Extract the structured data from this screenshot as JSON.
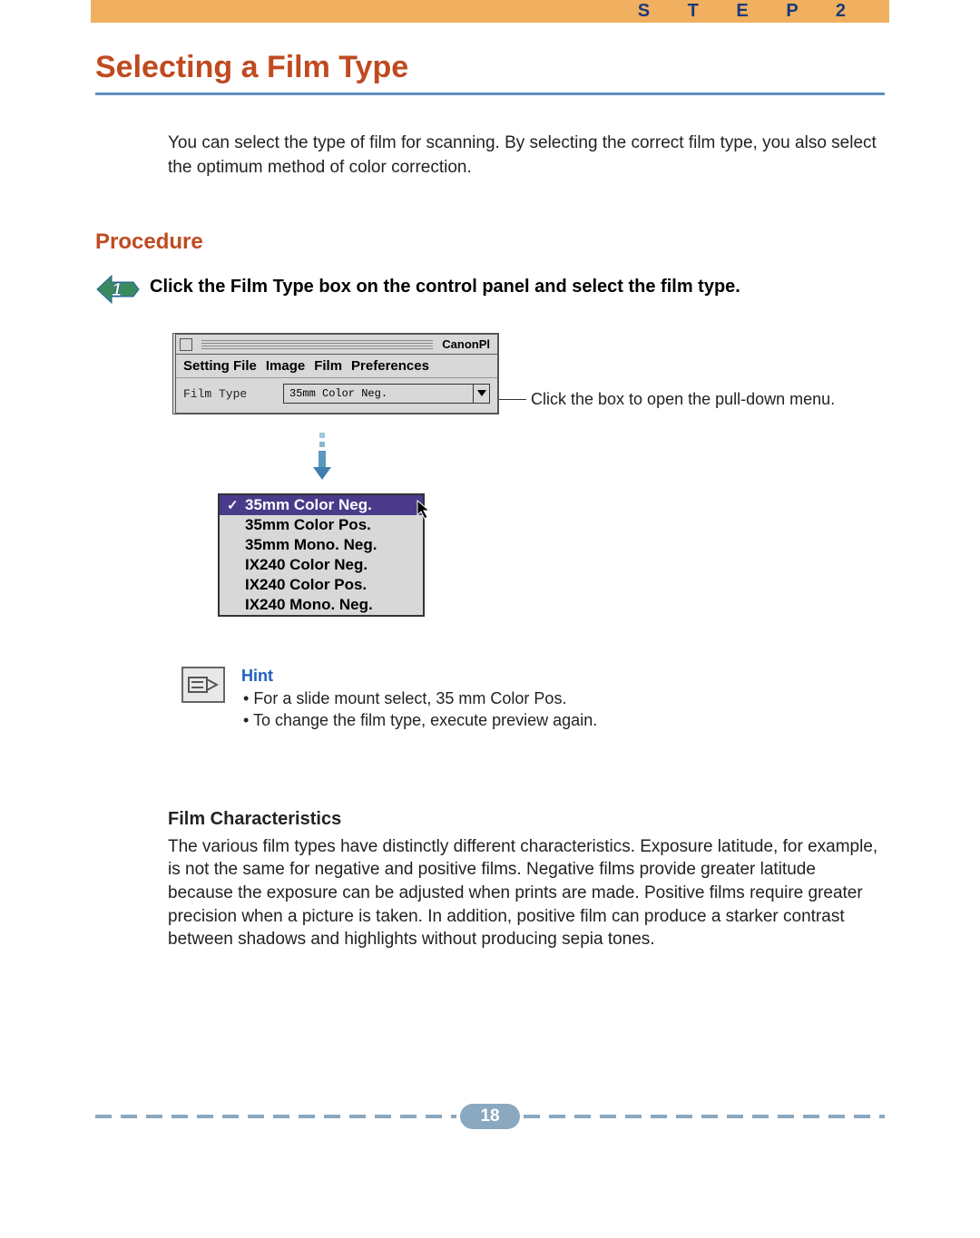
{
  "header": {
    "step_label": "S T E P   2"
  },
  "title": "Selecting a Film Type",
  "intro": "You can select the type of film for scanning.  By selecting the correct film type, you also select the optimum method of color correction.",
  "procedure": {
    "heading": "Procedure",
    "step_text": "Click the Film Type box on the control panel and select the film type."
  },
  "app": {
    "title": "CanonPl",
    "menubar": [
      "Setting File",
      "Image",
      "Film",
      "Preferences"
    ],
    "film_type_label": "Film Type",
    "dropdown_value": "35mm Color Neg.",
    "callout": "Click the box to open the pull-down menu.",
    "menu_items": [
      "35mm Color Neg.",
      "35mm Color Pos.",
      "35mm Mono. Neg.",
      "IX240 Color Neg.",
      "IX240 Color Pos.",
      "IX240 Mono. Neg."
    ],
    "selected_index": 0
  },
  "hint": {
    "label": "Hint",
    "items": [
      "For a slide mount select, 35 mm Color Pos.",
      "To change the film type, execute preview again."
    ]
  },
  "characteristics": {
    "heading": "Film Characteristics",
    "body": "The various film types have distinctly different characteristics. Exposure latitude, for example, is not the same for negative and positive films. Negative films provide greater latitude because the exposure can be adjusted when prints are made. Positive films require greater precision when a picture is taken. In addition, positive film can produce a starker contrast between shadows and highlights without producing sepia tones."
  },
  "page_number": "18"
}
